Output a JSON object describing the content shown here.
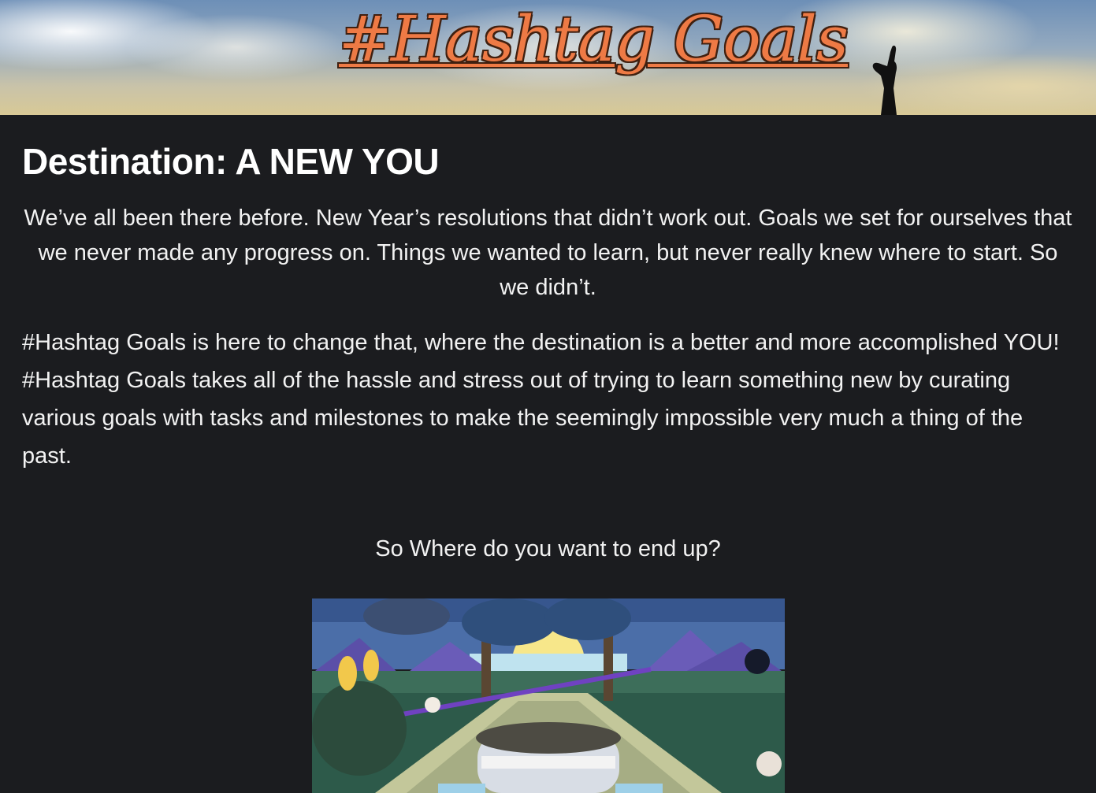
{
  "header": {
    "title": "#Hashtag Goals"
  },
  "main": {
    "heading": "Destination: A NEW YOU",
    "intro": "We’ve all been there before. New Year’s resolutions that didn’t work out. Goals we set for ourselves that we never made any progress on. Things we wanted to learn, but never really knew where to start. So we didn’t.",
    "mission": "#Hashtag Goals is here to change that, where the destination is a better and more accomplished YOU! #Hashtag Goals takes all of the hassle and stress out of trying to learn something new by curating various goals with tasks and milestones to make the seemingly impossible very much a thing of the past.",
    "question": "So Where do you want to end up?"
  },
  "colors": {
    "background": "#1b1c1f",
    "title_orange": "#ee7a45",
    "text": "#f2f2f2"
  }
}
